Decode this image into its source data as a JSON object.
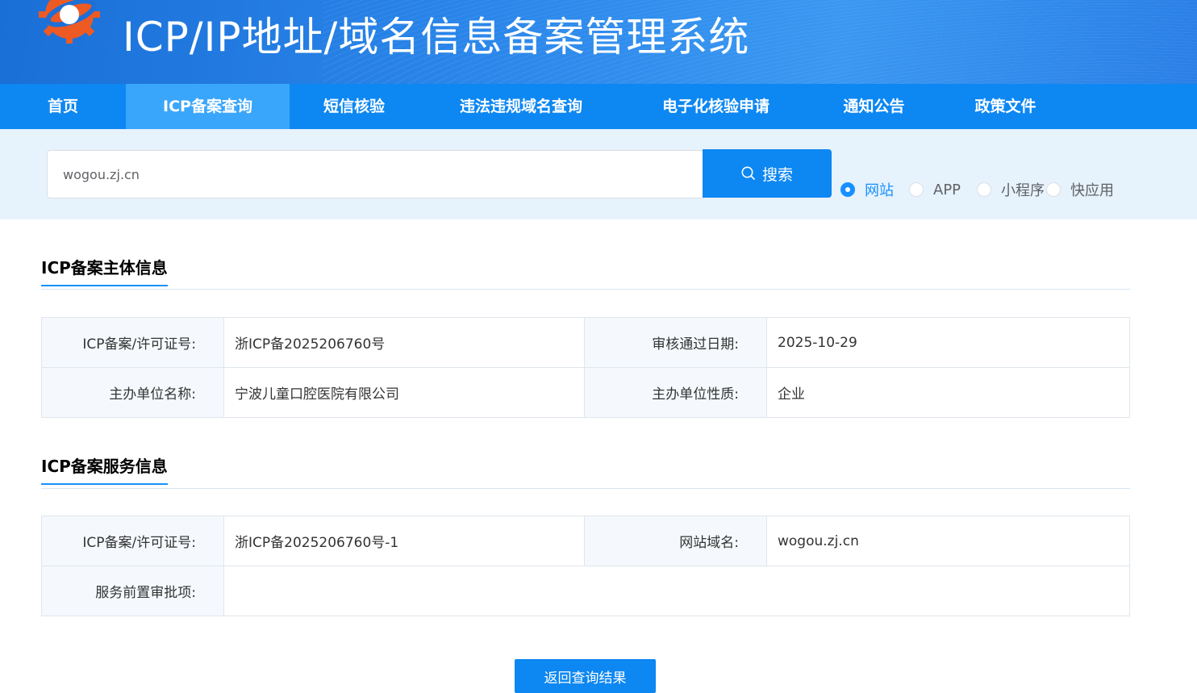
{
  "header": {
    "title": "ICP/IP地址/域名信息备案管理系统"
  },
  "nav": {
    "items": [
      {
        "label": "首页"
      },
      {
        "label": "ICP备案查询"
      },
      {
        "label": "短信核验"
      },
      {
        "label": "违法违规域名查询"
      },
      {
        "label": "电子化核验申请"
      },
      {
        "label": "通知公告"
      },
      {
        "label": "政策文件"
      }
    ],
    "active": "ICP备案查询"
  },
  "search": {
    "value": "wogou.zj.cn",
    "button_label": "搜索",
    "types": [
      {
        "label": "网站",
        "checked": true
      },
      {
        "label": "APP",
        "checked": false
      },
      {
        "label": "小程序",
        "checked": false
      },
      {
        "label": "快应用",
        "checked": false
      }
    ]
  },
  "subject_info": {
    "title": "ICP备案主体信息",
    "rows": [
      {
        "l1": "ICP备案/许可证号:",
        "v1": "浙ICP备2025206760号",
        "l2": "审核通过日期:",
        "v2": "2025-10-29"
      },
      {
        "l1": "主办单位名称:",
        "v1": "宁波儿童口腔医院有限公司",
        "l2": "主办单位性质:",
        "v2": "企业"
      }
    ]
  },
  "service_info": {
    "title": "ICP备案服务信息",
    "license_label": "ICP备案/许可证号:",
    "license_value": "浙ICP备2025206760号-1",
    "domain_label": "网站域名:",
    "domain_value": "wogou.zj.cn",
    "approval_label": "服务前置审批项:",
    "approval_value": ""
  },
  "back_button": "返回查询结果",
  "colors": {
    "primary": "#0d87f2",
    "nav_active": "#3aa6fb",
    "search_band": "#e6f2fc"
  }
}
